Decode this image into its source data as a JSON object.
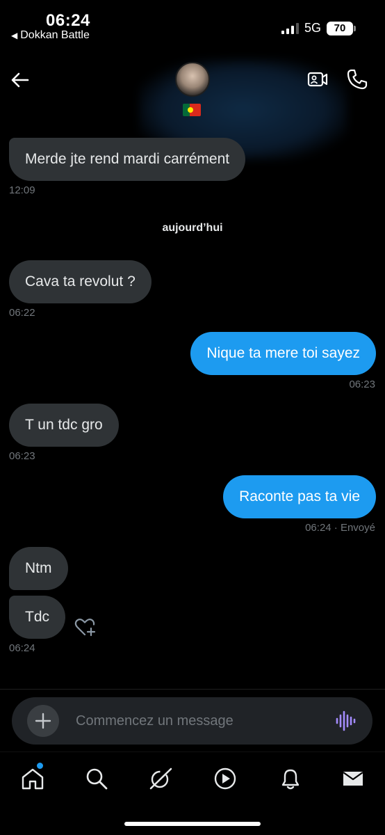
{
  "status_bar": {
    "time": "06:24",
    "back_app": "Dokkan Battle",
    "network": "5G",
    "battery": "70"
  },
  "header": {
    "back_icon": "arrow-left-icon",
    "video_call_icon": "video-camera-icon",
    "voice_call_icon": "phone-icon",
    "flag": "portugal-flag"
  },
  "thread": {
    "day_separator": "aujourd’hui",
    "messages": [
      {
        "direction": "in",
        "text": "Merde jte rend mardi carrément",
        "time": "12:09"
      },
      {
        "direction": "in",
        "text": "Cava ta revolut ?",
        "time": "06:22"
      },
      {
        "direction": "out",
        "text": "Nique ta mere toi sayez",
        "time": "06:23"
      },
      {
        "direction": "in",
        "text": "T un tdc gro",
        "time": "06:23"
      },
      {
        "direction": "out",
        "text": "Raconte pas ta vie",
        "time": "06:24 · Envoyé"
      },
      {
        "direction": "in",
        "text": "Ntm",
        "time": ""
      },
      {
        "direction": "in",
        "text": "Tdc",
        "time": "06:24"
      }
    ]
  },
  "composer": {
    "placeholder": "Commencez un message",
    "add_icon": "plus-icon",
    "voice_icon": "voice-waveform-icon"
  },
  "tabbar": {
    "items": [
      "home-icon",
      "search-icon",
      "grok-icon",
      "video-play-icon",
      "bell-icon",
      "mail-icon"
    ],
    "accent": "#1d9bf0"
  },
  "colors": {
    "background": "#000000",
    "incoming_bubble": "#2f3336",
    "outgoing_bubble": "#1d9bf0",
    "timestamp": "#71767b",
    "voice_icon": "#a48cff"
  }
}
